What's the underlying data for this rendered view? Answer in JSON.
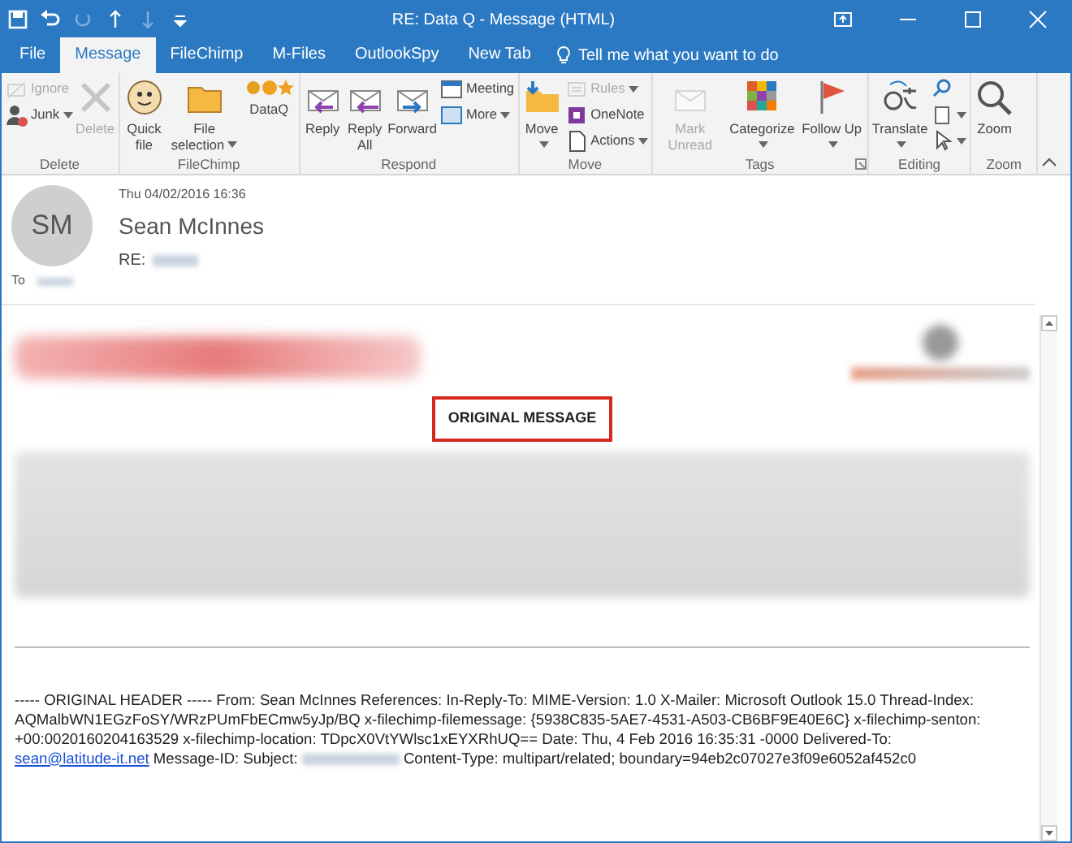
{
  "window": {
    "title": "RE: Data Q  -  Message (HTML)"
  },
  "quick_access": [
    {
      "disabled": false
    },
    {
      "disabled": false
    },
    {
      "disabled": true
    },
    {
      "disabled": false
    },
    {
      "disabled": true
    },
    {
      "disabled": false
    }
  ],
  "tabs": [
    {
      "label": "File",
      "selected": false
    },
    {
      "label": "Message",
      "selected": true
    },
    {
      "label": "FileChimp",
      "selected": false
    },
    {
      "label": "M-Files",
      "selected": false
    },
    {
      "label": "OutlookSpy",
      "selected": false
    },
    {
      "label": "New Tab",
      "selected": false
    }
  ],
  "tell_me": {
    "placeholder": "Tell me what you want to do"
  },
  "ribbon": [
    {
      "name": "Delete",
      "items": [
        {
          "kind": "small",
          "label": "Ignore",
          "disabled": true,
          "dropdown": false
        },
        {
          "kind": "small",
          "label": "Junk",
          "disabled": false,
          "dropdown": true
        },
        {
          "kind": "large",
          "label": "Delete",
          "disabled": true,
          "dropdown": false
        }
      ]
    },
    {
      "name": "FileChimp",
      "items": [
        {
          "kind": "large",
          "label": "Quick file",
          "disabled": false,
          "dropdown": false
        },
        {
          "kind": "large",
          "label": "File selection",
          "disabled": false,
          "dropdown": true
        },
        {
          "kind": "cluster",
          "label": "DataQ",
          "disabled": false,
          "dropdown": false
        }
      ]
    },
    {
      "name": "Respond",
      "items": [
        {
          "kind": "large",
          "label": "Reply",
          "disabled": false,
          "dropdown": false
        },
        {
          "kind": "large",
          "label": "Reply All",
          "disabled": false,
          "dropdown": false
        },
        {
          "kind": "large",
          "label": "Forward",
          "disabled": false,
          "dropdown": false
        },
        {
          "kind": "small",
          "label": "Meeting",
          "disabled": false,
          "dropdown": false
        },
        {
          "kind": "small",
          "label": "More",
          "disabled": false,
          "dropdown": true
        }
      ]
    },
    {
      "name": "Move",
      "items": [
        {
          "kind": "large",
          "label": "Move",
          "disabled": false,
          "dropdown": true
        },
        {
          "kind": "small",
          "label": "Rules",
          "disabled": true,
          "dropdown": true
        },
        {
          "kind": "small",
          "label": "OneNote",
          "disabled": false,
          "dropdown": false
        },
        {
          "kind": "small",
          "label": "Actions",
          "disabled": false,
          "dropdown": true
        }
      ]
    },
    {
      "name": "Tags",
      "dialog_launcher": true,
      "items": [
        {
          "kind": "large",
          "label": "Mark Unread",
          "disabled": true,
          "dropdown": false
        },
        {
          "kind": "large",
          "label": "Categorize",
          "disabled": false,
          "dropdown": true
        },
        {
          "kind": "large",
          "label": "Follow Up",
          "disabled": false,
          "dropdown": true
        }
      ]
    },
    {
      "name": "Editing",
      "items": [
        {
          "kind": "large",
          "label": "Translate",
          "disabled": false,
          "dropdown": true
        },
        {
          "kind": "small",
          "disabled": false,
          "dropdown": false
        },
        {
          "kind": "small",
          "disabled": false,
          "dropdown": true
        },
        {
          "kind": "small",
          "disabled": false,
          "dropdown": true
        }
      ]
    },
    {
      "name": "Zoom",
      "items": [
        {
          "kind": "large",
          "label": "Zoom",
          "disabled": false,
          "dropdown": false
        }
      ]
    }
  ],
  "message": {
    "avatar": "SM",
    "date": "Thu 04/02/2016 16:36",
    "sender": "Sean McInnes",
    "subject_prefix": "RE:",
    "to_label": "To"
  },
  "body": {
    "banner": "ORIGINAL MESSAGE",
    "header_text": [
      {
        "kind": "text",
        "text": "----- ORIGINAL HEADER ----- From: Sean McInnes References: In-Reply-To: MIME-Version: 1.0 X-Mailer: Microsoft Outlook 15.0 Thread-Index: AQMalbWN1EGzFoSY/WRzPUmFbECmw5yJp/BQ x-filechimp-filemessage: {5938C835-5AE7-4531-A503-CB6BF9E40E6C} x-filechimp-senton: +00:0020160204163529 x-filechimp-location: TDpcX0VtYWlsc1xEYXRhUQ== Date: Thu, 4 Feb 2016 16:35:31 -0000 Delivered-To: "
      },
      {
        "kind": "link",
        "text": "sean@latitude-it.net"
      },
      {
        "kind": "text",
        "text": " Message-ID: Subject: "
      },
      {
        "kind": "redacted"
      },
      {
        "kind": "text",
        "text": " Content-Type: multipart/related; boundary=94eb2c07027e3f09e6052af452c0"
      }
    ]
  }
}
